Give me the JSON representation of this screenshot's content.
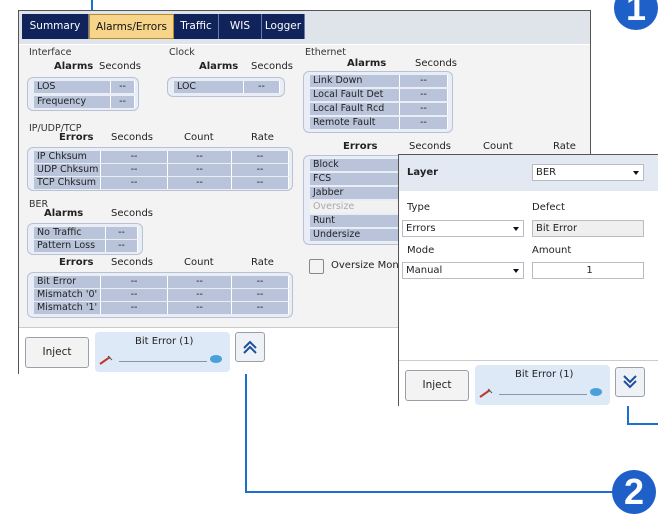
{
  "tabs": [
    "Summary",
    "Alarms/Errors",
    "Traffic",
    "WIS",
    "Logger"
  ],
  "interface": {
    "title": "Interface",
    "col_alarms": "Alarms",
    "col_seconds": "Seconds",
    "rows": [
      {
        "label": "LOS",
        "seconds": "--"
      },
      {
        "label": "Frequency",
        "seconds": "--"
      }
    ]
  },
  "clock": {
    "title": "Clock",
    "col_alarms": "Alarms",
    "col_seconds": "Seconds",
    "rows": [
      {
        "label": "LOC",
        "seconds": "--"
      }
    ]
  },
  "ipudptcp": {
    "title": "IP/UDP/TCP",
    "col_errors": "Errors",
    "col_seconds": "Seconds",
    "col_count": "Count",
    "col_rate": "Rate",
    "rows": [
      {
        "label": "IP Chksum",
        "seconds": "--",
        "count": "--",
        "rate": "--"
      },
      {
        "label": "UDP Chksum",
        "seconds": "--",
        "count": "--",
        "rate": "--"
      },
      {
        "label": "TCP Chksum",
        "seconds": "--",
        "count": "--",
        "rate": "--"
      }
    ]
  },
  "ber": {
    "title": "BER",
    "col_alarms": "Alarms",
    "col_seconds": "Seconds",
    "alarm_rows": [
      {
        "label": "No Traffic",
        "seconds": "--"
      },
      {
        "label": "Pattern Loss",
        "seconds": "--"
      }
    ],
    "col_errors": "Errors",
    "col_count": "Count",
    "col_rate": "Rate",
    "error_rows": [
      {
        "label": "Bit Error",
        "seconds": "--",
        "count": "--",
        "rate": "--"
      },
      {
        "label": "Mismatch '0'",
        "seconds": "--",
        "count": "--",
        "rate": "--"
      },
      {
        "label": "Mismatch '1'",
        "seconds": "--",
        "count": "--",
        "rate": "--"
      }
    ]
  },
  "ethernet": {
    "title": "Ethernet",
    "col_alarms": "Alarms",
    "col_seconds": "Seconds",
    "alarm_rows": [
      {
        "label": "Link Down",
        "seconds": "--"
      },
      {
        "label": "Local Fault Det",
        "seconds": "--"
      },
      {
        "label": "Local Fault Rcd",
        "seconds": "--"
      },
      {
        "label": "Remote Fault",
        "seconds": "--"
      }
    ],
    "col_errors": "Errors",
    "col_count": "Count",
    "col_rate": "Rate",
    "error_rows": [
      "Block",
      "FCS",
      "Jabber",
      "Oversize",
      "Runt",
      "Undersize"
    ],
    "oversize_monitor": "Oversize Monito"
  },
  "bottom": {
    "inject": "Inject",
    "status": "Bit Error (1)"
  },
  "popup": {
    "layer_label": "Layer",
    "layer_value": "BER",
    "type_label": "Type",
    "type_value": "Errors",
    "defect_label": "Defect",
    "defect_value": "Bit Error",
    "mode_label": "Mode",
    "mode_value": "Manual",
    "amount_label": "Amount",
    "amount_value": "1",
    "inject": "Inject",
    "status": "Bit Error (1)"
  },
  "badges": {
    "one": "1",
    "two": "2"
  },
  "colors": {
    "tab_bg": "#10235a",
    "tab_active": "#f6d58a",
    "cell": "#b9c4da",
    "callout": "#1a6fd1",
    "badge": "#1e5fc8"
  }
}
